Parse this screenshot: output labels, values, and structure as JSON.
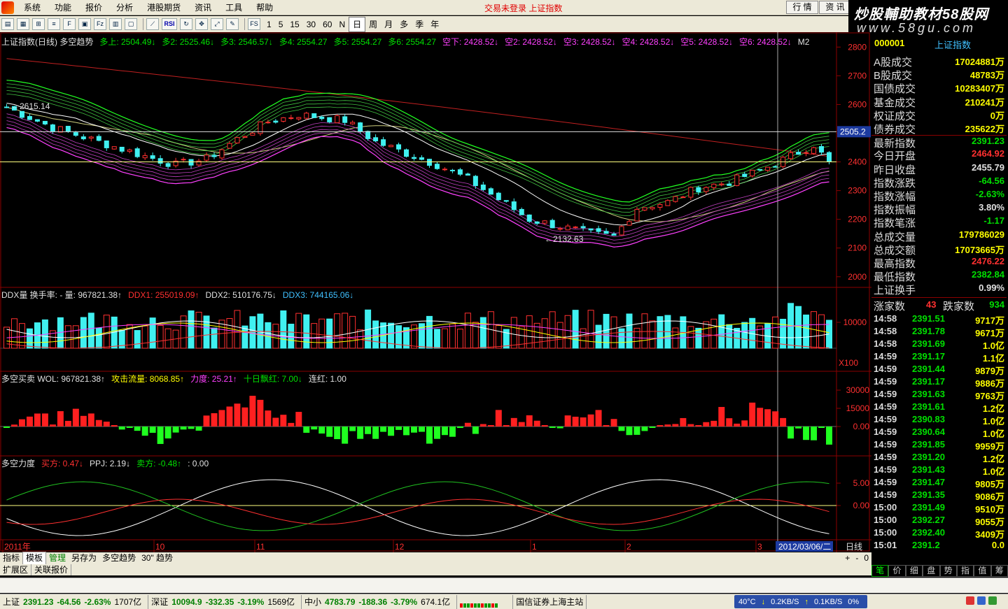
{
  "menubar": {
    "items": [
      "系统",
      "功能",
      "报价",
      "分析",
      "港股期货",
      "资讯",
      "工具",
      "帮助"
    ],
    "login_status": "交易未登录  上证指数",
    "right_tabs": [
      "行 情",
      "资 讯"
    ]
  },
  "brand": {
    "line1": "炒股輔助教材58股网",
    "line2": "www.58gu.com"
  },
  "toolbar": {
    "periods": [
      "1",
      "5",
      "15",
      "30",
      "60",
      "N",
      "日",
      "周",
      "月",
      "多",
      "季",
      "年"
    ],
    "selected_period": "日"
  },
  "main_chart": {
    "header": [
      {
        "text": "上证指数(日线) 多空趋势",
        "color": "#e0e0e0"
      },
      {
        "text": "多上: 2504.49↓",
        "color": "#00e000"
      },
      {
        "text": "多2: 2525.46↓",
        "color": "#00e000"
      },
      {
        "text": "多3: 2546.57↓",
        "color": "#00e000"
      },
      {
        "text": "多4: 2554.27",
        "color": "#00e000"
      },
      {
        "text": "多5: 2554.27",
        "color": "#00e000"
      },
      {
        "text": "多6: 2554.27",
        "color": "#00e000"
      },
      {
        "text": "空下: 2428.52↓",
        "color": "#ff40ff"
      },
      {
        "text": "空2: 2428.52↓",
        "color": "#ff40ff"
      },
      {
        "text": "空3: 2428.52↓",
        "color": "#ff40ff"
      },
      {
        "text": "空4: 2428.52↓",
        "color": "#ff40ff"
      },
      {
        "text": "空5: 2428.52↓",
        "color": "#ff40ff"
      },
      {
        "text": "空6: 2428.52↓",
        "color": "#ff40ff"
      },
      {
        "text": "M2",
        "color": "#e0e0e0"
      }
    ],
    "y_ticks": [
      "2800",
      "2700",
      "2600",
      "2500",
      "2400",
      "2300",
      "2200",
      "2100",
      "2000"
    ],
    "cursor_price": "2505.2",
    "high_label": "2615.14",
    "low_label": "2132.63",
    "y_range": [
      1980,
      2830
    ]
  },
  "ddx_panel": {
    "header": [
      {
        "text": "DDX量  换手率: -  量: 967821.38↑",
        "color": "#e0e0e0"
      },
      {
        "text": "DDX1: 255019.09↑",
        "color": "#ff3030"
      },
      {
        "text": "DDX2: 510176.75↓",
        "color": "#e0e0e0"
      },
      {
        "text": "DDX3: 744165.06↓",
        "color": "#40c0ff"
      }
    ],
    "y_ticks": [
      "10000"
    ],
    "unit": "X100"
  },
  "buysell_panel": {
    "header": [
      {
        "text": "多空买卖  WOL: 967821.38↑",
        "color": "#e0e0e0"
      },
      {
        "text": "攻击流量: 8068.85↑",
        "color": "#ffff00"
      },
      {
        "text": "力度: 25.21↑",
        "color": "#ff40ff"
      },
      {
        "text": "十日飘红: 7.00↓",
        "color": "#00e000"
      },
      {
        "text": "连红: 1.00",
        "color": "#e0e0e0"
      }
    ],
    "y_ticks": [
      "30000",
      "15000",
      "0.00"
    ]
  },
  "force_panel": {
    "header": [
      {
        "text": "多空力度",
        "color": "#e0e0e0"
      },
      {
        "text": "买方: 0.47↓",
        "color": "#ff3030"
      },
      {
        "text": "PPJ: 2.19↓",
        "color": "#e0e0e0"
      },
      {
        "text": "卖方: -0.48↑",
        "color": "#00e000"
      },
      {
        "text": ": 0.00",
        "color": "#e0e0e0"
      }
    ],
    "y_ticks": [
      "5.00",
      "0.00"
    ]
  },
  "x_axis": {
    "labels": [
      "2011年",
      "10",
      "11",
      "12",
      "1",
      "2",
      "3"
    ],
    "cursor_date": "2012/03/06/二",
    "period_label": "日线"
  },
  "bottom_tabs": [
    "指标",
    "模板",
    "管理",
    "另存为",
    "多空趋势",
    "30\" 趋势"
  ],
  "bottom_tabs_selected": "模板",
  "ext_tabs": [
    "扩展区",
    "关联报价"
  ],
  "right_panel": {
    "code": "000001",
    "name": "上证指数",
    "stats": [
      {
        "label": "A股成交",
        "value": "17024881万",
        "color": "#ffff00"
      },
      {
        "label": "B股成交",
        "value": "48783万",
        "color": "#ffff00"
      },
      {
        "label": "国债成交",
        "value": "10283407万",
        "color": "#ffff00"
      },
      {
        "label": "基金成交",
        "value": "210241万",
        "color": "#ffff00"
      },
      {
        "label": "权证成交",
        "value": "0万",
        "color": "#ffff00"
      },
      {
        "label": "债券成交",
        "value": "235622万",
        "color": "#ffff00"
      },
      {
        "label": "最新指数",
        "value": "2391.23",
        "color": "#00e000"
      },
      {
        "label": "今日开盘",
        "value": "2464.92",
        "color": "#ff3030"
      },
      {
        "label": "昨日收盘",
        "value": "2455.79",
        "color": "#e0e0e0"
      },
      {
        "label": "指数涨跌",
        "value": "-64.56",
        "color": "#00e000"
      },
      {
        "label": "指数涨幅",
        "value": "-2.63%",
        "color": "#00e000"
      },
      {
        "label": "指数振幅",
        "value": "3.80%",
        "color": "#e0e0e0"
      },
      {
        "label": "指数笔涨",
        "value": "-1.17",
        "color": "#00e000"
      },
      {
        "label": "总成交量",
        "value": "179786029",
        "color": "#ffff00"
      },
      {
        "label": "总成交额",
        "value": "17073665万",
        "color": "#ffff00"
      },
      {
        "label": "最高指数",
        "value": "2476.22",
        "color": "#ff3030"
      },
      {
        "label": "最低指数",
        "value": "2382.84",
        "color": "#00e000"
      },
      {
        "label": "上证换手",
        "value": "0.99%",
        "color": "#e0e0e0"
      }
    ],
    "updown": {
      "up_label": "涨家数",
      "up_value": "43",
      "down_label": "跌家数",
      "down_value": "934"
    },
    "ticks": [
      {
        "t": "14:58",
        "p": "2391.51",
        "v": "9717万"
      },
      {
        "t": "14:58",
        "p": "2391.78",
        "v": "9671万"
      },
      {
        "t": "14:58",
        "p": "2391.69",
        "v": "1.0亿"
      },
      {
        "t": "14:59",
        "p": "2391.17",
        "v": "1.1亿"
      },
      {
        "t": "14:59",
        "p": "2391.44",
        "v": "9879万"
      },
      {
        "t": "14:59",
        "p": "2391.17",
        "v": "9886万"
      },
      {
        "t": "14:59",
        "p": "2391.63",
        "v": "9763万"
      },
      {
        "t": "14:59",
        "p": "2391.61",
        "v": "1.2亿"
      },
      {
        "t": "14:59",
        "p": "2390.83",
        "v": "1.0亿"
      },
      {
        "t": "14:59",
        "p": "2390.64",
        "v": "1.0亿"
      },
      {
        "t": "14:59",
        "p": "2391.85",
        "v": "9959万"
      },
      {
        "t": "14:59",
        "p": "2391.20",
        "v": "1.2亿"
      },
      {
        "t": "14:59",
        "p": "2391.43",
        "v": "1.0亿"
      },
      {
        "t": "14:59",
        "p": "2391.47",
        "v": "9805万"
      },
      {
        "t": "14:59",
        "p": "2391.35",
        "v": "9086万"
      },
      {
        "t": "15:00",
        "p": "2391.49",
        "v": "9510万"
      },
      {
        "t": "15:00",
        "p": "2392.27",
        "v": "9055万"
      },
      {
        "t": "15:00",
        "p": "2392.40",
        "v": "3409万"
      },
      {
        "t": "15:01",
        "p": "2391.2",
        "v": "0.0"
      }
    ],
    "bottom_tabs": [
      "笔",
      "价",
      "细",
      "盘",
      "势",
      "指",
      "值",
      "筹"
    ],
    "bottom_tab_selected": "笔"
  },
  "statusbar": {
    "indices": [
      {
        "name": "上证",
        "value": "2391.23",
        "chg": "-64.56",
        "pct": "-2.63%",
        "amt": "1707亿"
      },
      {
        "name": "深证",
        "value": "10094.9",
        "chg": "-332.35",
        "pct": "-3.19%",
        "amt": "1569亿"
      },
      {
        "name": "中小",
        "value": "4783.79",
        "chg": "-188.36",
        "pct": "-3.79%",
        "amt": "674.1亿"
      }
    ],
    "broker": "国信证券上海主站",
    "temp": "40°C",
    "down_speed": "0.2KB/S",
    "up_speed": "0.1KB/S",
    "cpu": "0%"
  },
  "colors": {
    "up": "#ff3030",
    "down": "#40f0f0",
    "green": "#00e000",
    "magenta": "#ff40ff",
    "yellow": "#ffff00",
    "frame": "#8b0000"
  }
}
